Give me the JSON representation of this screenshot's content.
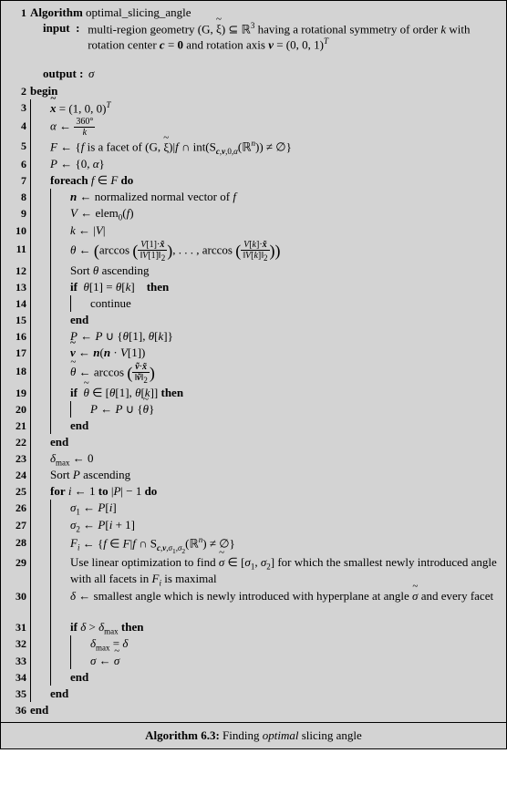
{
  "algorithm": {
    "number": "1",
    "name": "optimal_slicing_angle",
    "title_prefix": "Algorithm",
    "input_label": "input",
    "output_label": "output",
    "output_value": "σ",
    "begin": "begin",
    "end": "end",
    "foreach": "foreach",
    "do": "do",
    "for": "for",
    "to": "to",
    "if": "if",
    "then": "then",
    "continue": "continue"
  },
  "lines": {
    "l3": "x̃ = (1,0,0)ᵀ",
    "l6": "P ← {0, α}",
    "l9": "V ← elem₀(f)",
    "l10": "k ← |V|",
    "l13": "if θ[1] = θ[k] then",
    "l16": "P ← P ∪ {θ[1], θ[k]}",
    "l23": "δmax ← 0",
    "l24": "Sort P ascending",
    "l26": "σ₁ ← P[i]",
    "l27": "σ₂ ← P[i+1]",
    "l31": "if δ > δmax then",
    "l32": "δmax = δ",
    "l33": "σ ← σ̃"
  },
  "caption": {
    "label": "Algorithm 6.3:",
    "text": "Finding optimal slicing angle"
  }
}
